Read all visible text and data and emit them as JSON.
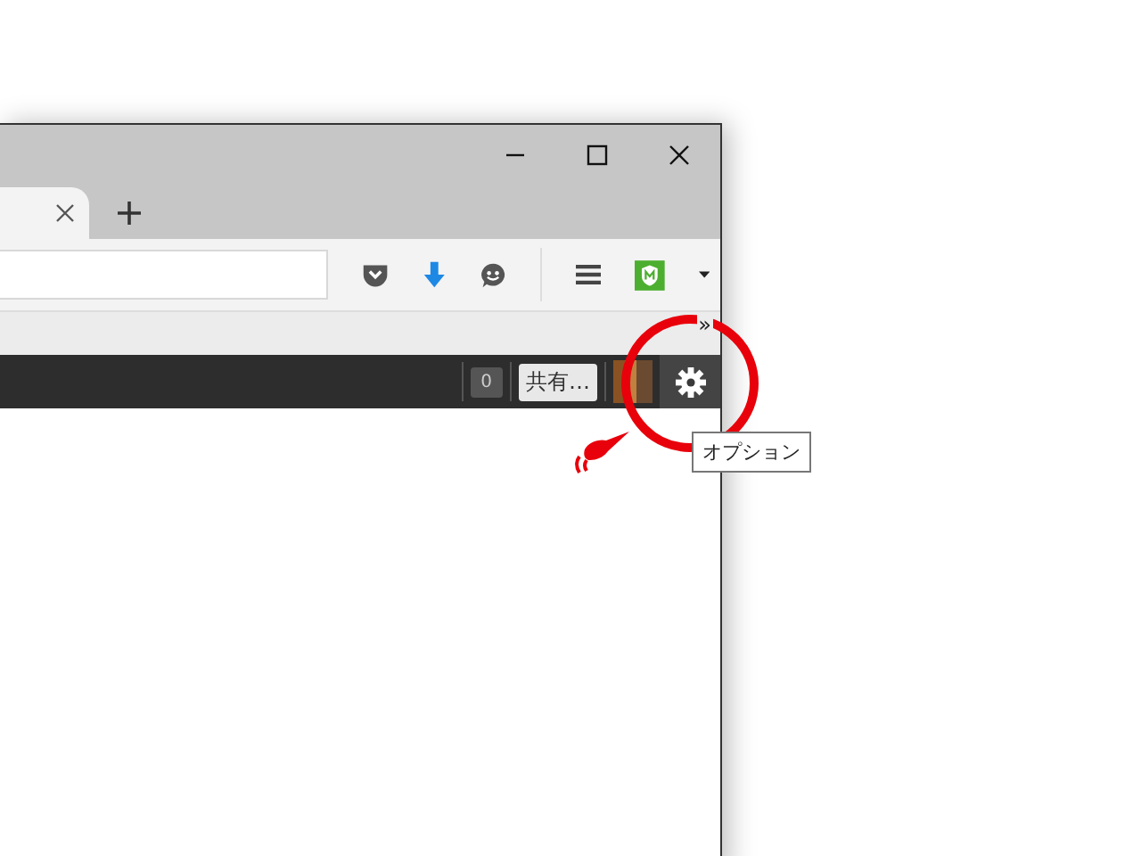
{
  "bookmarks_bar": {
    "overflow": "»"
  },
  "addon_bar": {
    "count": "0",
    "share_button": "共有…"
  },
  "tooltip": {
    "text": "オプション"
  }
}
